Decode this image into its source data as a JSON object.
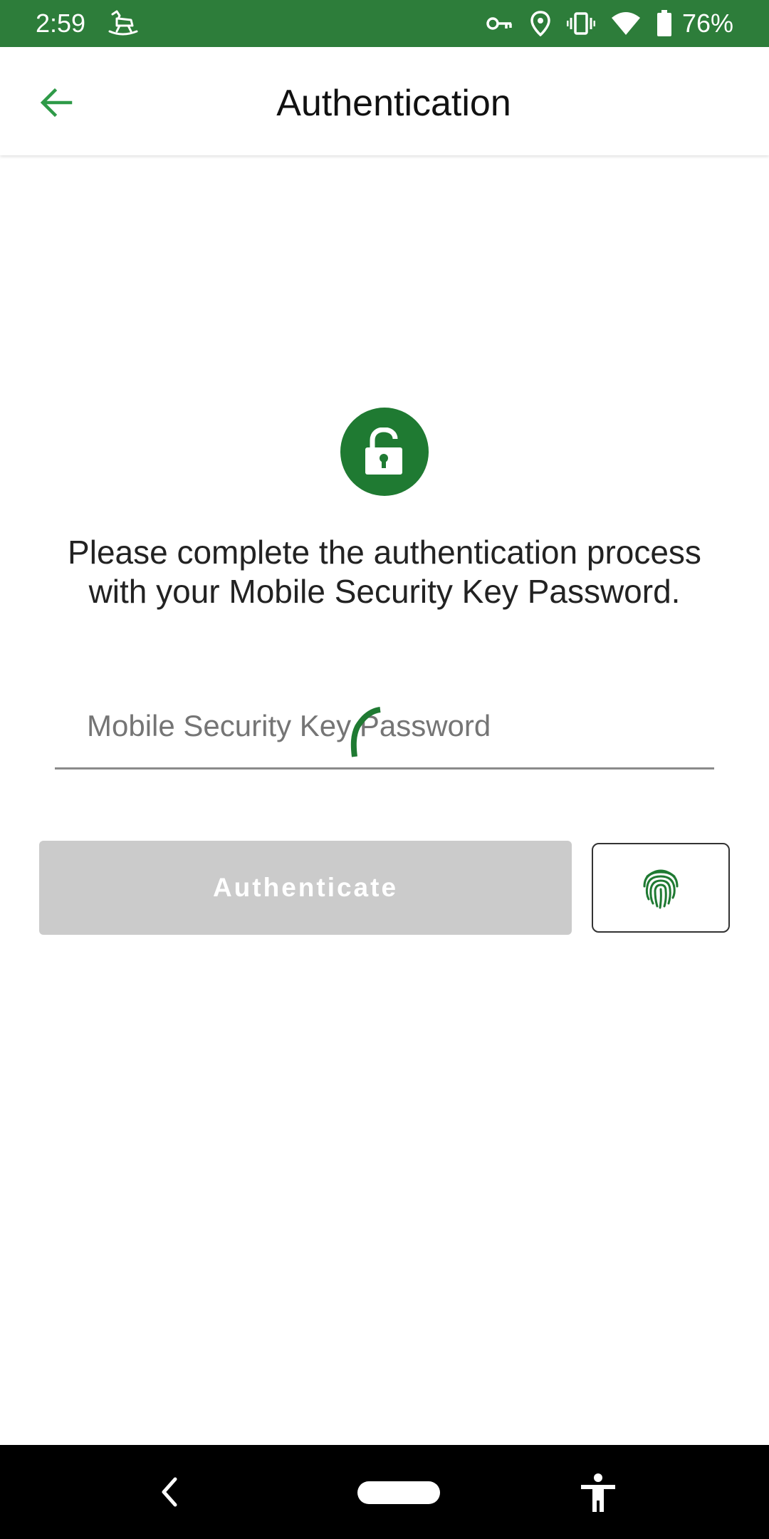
{
  "status_bar": {
    "time": "2:59",
    "battery_percent": "76%",
    "icons": [
      "rocking-horse-icon",
      "vpn-key-icon",
      "location-icon",
      "vibrate-icon",
      "wifi-icon",
      "battery-icon"
    ],
    "background_color": "#2d7d3a"
  },
  "app_bar": {
    "title": "Authentication",
    "back_icon": "arrow-back-icon",
    "accent_color": "#2e9a48"
  },
  "main": {
    "lock_icon": "lock-open-icon",
    "instruction": "Please complete the authentication process with your Mobile Security Key Password.",
    "password_placeholder": "Mobile Security Key Password",
    "password_value": "",
    "loading": true,
    "authenticate_label": "Authenticate",
    "authenticate_enabled": false,
    "fingerprint_icon": "fingerprint-icon",
    "brand_color": "#1f7a32"
  },
  "nav_bar": {
    "icons": [
      "nav-back-icon",
      "nav-home-pill",
      "accessibility-icon"
    ]
  }
}
